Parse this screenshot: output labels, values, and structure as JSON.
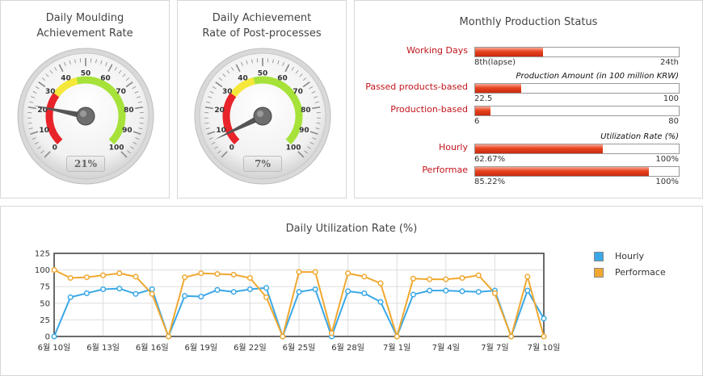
{
  "moulding": {
    "title_line1": "Daily Moulding",
    "title_line2": "Achievement Rate",
    "value": 21,
    "display": "21%"
  },
  "post": {
    "title_line1": "Daily Achievement",
    "title_line2": "Rate of Post-processes",
    "value": 7,
    "display": "7%"
  },
  "gauge_scale": {
    "ticks": [
      "0",
      "10",
      "20",
      "30",
      "40",
      "50",
      "60",
      "70",
      "80",
      "90",
      "100"
    ],
    "band_colors": {
      "low": "#e8232a",
      "mid": "#f5e83a",
      "high": "#a6e23a"
    }
  },
  "monthly": {
    "title": "Monthly Production Status",
    "working_days": {
      "label": "Working Days",
      "fraction": 0.333,
      "left": "8th(lapse)",
      "right": "24th"
    },
    "amount_heading": "Production Amount (in 100 million KRW)",
    "passed": {
      "label": "Passed products-based",
      "fraction": 0.225,
      "left": "22.5",
      "right": "100"
    },
    "production": {
      "label": "Production-based",
      "fraction": 0.075,
      "left": "6",
      "right": "80"
    },
    "util_heading": "Utilization Rate (%)",
    "hourly": {
      "label": "Hourly",
      "fraction": 0.6267,
      "left": "62.67%",
      "right": "100%"
    },
    "performae": {
      "label": "Performae",
      "fraction": 0.8522,
      "left": "85.22%",
      "right": "100%"
    }
  },
  "daily": {
    "title": "Daily Utilization Rate (%)",
    "legend": [
      {
        "label": "Hourly",
        "color": "#3aa8e6"
      },
      {
        "label": "Performace",
        "color": "#f0a830"
      }
    ]
  },
  "chart_data": {
    "type": "line",
    "title": "Daily Utilization Rate (%)",
    "xlabel": "",
    "ylabel": "",
    "ylim": [
      0,
      125
    ],
    "yticks": [
      0,
      25,
      50,
      75,
      100,
      125
    ],
    "x_tick_labels": [
      "6월 10일",
      "6월 13일",
      "6월 16일",
      "6월 19일",
      "6월 22일",
      "6월 25일",
      "6월 28일",
      "7월 1일",
      "7월 4일",
      "7월 7일",
      "7월 10일"
    ],
    "x_count": 31,
    "series": [
      {
        "name": "Hourly",
        "color": "#3aa8e6",
        "values": [
          0,
          59,
          65,
          71,
          72,
          64,
          71,
          0,
          61,
          60,
          70,
          67,
          71,
          73,
          0,
          67,
          71,
          0,
          68,
          65,
          52,
          0,
          63,
          69,
          69,
          68,
          67,
          69,
          0,
          69,
          27
        ]
      },
      {
        "name": "Performace",
        "color": "#f0a830",
        "values": [
          100,
          88,
          89,
          92,
          95,
          90,
          64,
          0,
          89,
          95,
          94,
          93,
          88,
          59,
          0,
          97,
          97,
          5,
          95,
          90,
          80,
          0,
          87,
          86,
          86,
          88,
          92,
          65,
          0,
          90,
          0
        ]
      }
    ]
  }
}
